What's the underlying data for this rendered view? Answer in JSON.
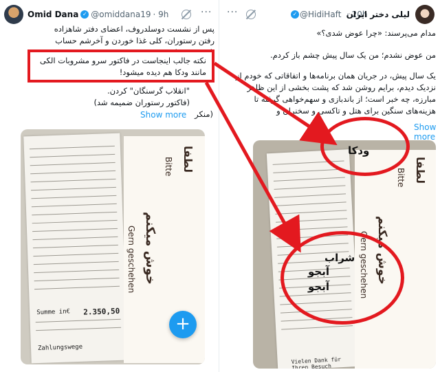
{
  "left_tweet": {
    "name": "Omid Dana",
    "handle": "@omiddana19",
    "time": "· 9h",
    "text_before": "پس از نشست دوسلدروف، اعضای دفتر شاهزاده رفتن رستوران، کلی غذا خوردن و آخرشم حساب نکردن و فرار",
    "highlighted": "نکته جالب اینجاست در فاکتور سرو مشروبات الکی مانند ودکا هم دیده میشود!",
    "text_after": "\"انقلاب گرسنگان\" کردن.",
    "text_after_2": "(فاکتور رستوران ضمیمه شد)",
    "text_after_3": "(منکر",
    "show_more": "Show more",
    "receipt_total_label": "Summe in€",
    "receipt_total": "2.350,50",
    "receipt_header": "Zahlungswege"
  },
  "right_tweet": {
    "name": "لیلی دختر ایران",
    "handle": "@HidiHaft",
    "time": "· 20h",
    "line1": "مدام می‌پرسند: «چرا عوض شدی؟»",
    "line2": "من عوض نشدم؛ من یک سال پیش چشم باز کردم.",
    "line3": "یک سال پیش، در جریان همان برنامه‌ها و اتفاقاتی که خودم از نزدیک دیدم، برایم روشن شد که پشت بخشی از این ظاهر مبارزه، چه خبر است؛ از باندبازی و سهم‌خواهی گرفته تا هزینه‌های سنگین برای هتل و تاکسی و سخنران و",
    "show_more": "Show more",
    "label_vodka": "ودکا",
    "label_wine": "شراب",
    "label_beer1": "آبجو",
    "label_beer2": "آبجو",
    "menu_persian": "خوش میکنم",
    "menu_german1": "Gern geschehen",
    "menu_german2": "Bitte",
    "menu_persian2": "لطفا",
    "receipt_footer": "Vielen Dank für Ihren Besuch"
  },
  "fab": {
    "label": "+"
  },
  "colors": {
    "annotation_red": "#e3191f",
    "link_blue": "#1d9bf0"
  }
}
